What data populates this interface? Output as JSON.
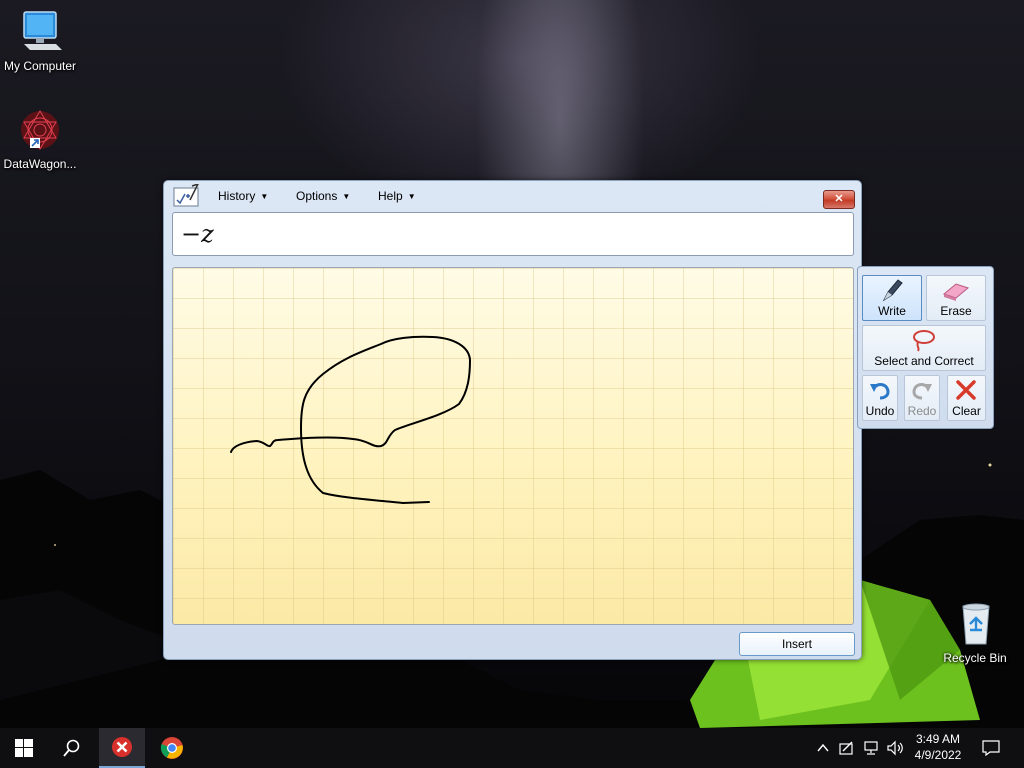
{
  "desktop": {
    "icons": [
      {
        "label": "My Computer"
      },
      {
        "label": "DataWagon..."
      },
      {
        "label": "Recycle Bin"
      }
    ]
  },
  "tip_window": {
    "menus": [
      {
        "label": "History"
      },
      {
        "label": "Options"
      },
      {
        "label": "Help"
      }
    ],
    "close_symbol": "✕",
    "preview_text": "−z",
    "insert_label": "Insert"
  },
  "tools": {
    "write": "Write",
    "erase": "Erase",
    "select_correct": "Select and Correct",
    "undo": "Undo",
    "redo": "Redo",
    "clear": "Clear"
  },
  "taskbar": {
    "time": "3:49 AM",
    "date": "4/9/2022",
    "icons": [
      "start-icon",
      "search-icon",
      "app-error-icon",
      "chrome-icon"
    ],
    "tray_icons": [
      "chevron-up-icon",
      "pen-input-icon",
      "network-icon",
      "volume-icon",
      "notification-icon"
    ]
  },
  "colors": {
    "accent": "#5a8cc4",
    "pad_yellow": "#fff6c8",
    "close_red": "#c23a24",
    "tent_green": "#7fd22a"
  }
}
